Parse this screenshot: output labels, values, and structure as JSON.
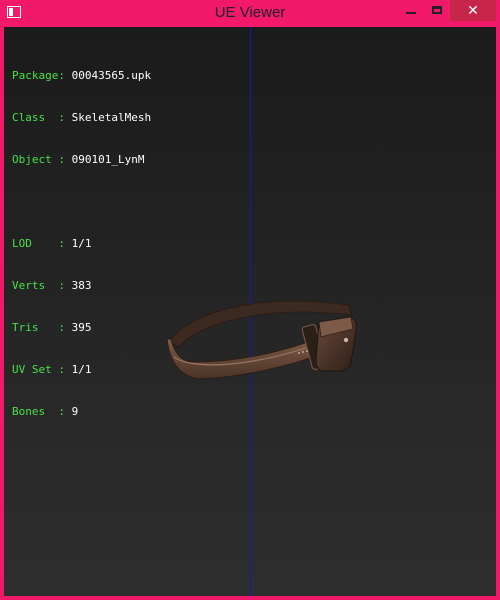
{
  "window": {
    "title": "UE Viewer",
    "close_glyph": "✕"
  },
  "info": {
    "package": {
      "label": "Package:",
      "value": "00043565.upk"
    },
    "class": {
      "label": "Class  :",
      "value": "SkeletalMesh"
    },
    "object": {
      "label": "Object :",
      "value": "090101_LynM"
    },
    "lod": {
      "label": "LOD    :",
      "value": "1/1"
    },
    "verts": {
      "label": "Verts  :",
      "value": "383"
    },
    "tris": {
      "label": "Tris   :",
      "value": "395"
    },
    "uvset": {
      "label": "UV Set :",
      "value": "1/1"
    },
    "bones": {
      "label": "Bones  :",
      "value": "9"
    }
  },
  "colors": {
    "frame": "#f2196b",
    "label": "#47e247",
    "value": "#ffffff",
    "axis_line": "#1515c8"
  },
  "icons": [
    "app-icon",
    "minimize-icon",
    "maximize-icon",
    "close-icon"
  ]
}
